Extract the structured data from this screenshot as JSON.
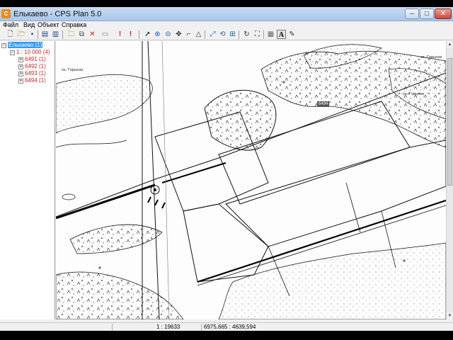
{
  "window": {
    "title": "Елькаево - CPS Plan 5.0",
    "app_icon": "cps-plan-icon",
    "controls": {
      "minimize": "–",
      "maximize": "□",
      "close": "✕"
    }
  },
  "menu": [
    {
      "label": "Файл"
    },
    {
      "label": "Вид"
    },
    {
      "label": "Объект"
    },
    {
      "label": "Справка"
    }
  ],
  "toolbar": [
    {
      "icon": "new-file-icon",
      "glyph": "🗋"
    },
    {
      "icon": "open-folder-icon",
      "glyph": "🗁"
    },
    {
      "icon": "save-icon",
      "glyph": "▪"
    },
    {
      "icon": "print-icon",
      "glyph": "▤"
    },
    {
      "icon": "print-preview-icon",
      "glyph": "▥"
    },
    {
      "icon": "open-layer-icon",
      "glyph": "🗀"
    },
    {
      "icon": "copy-icon",
      "glyph": "⧉"
    },
    {
      "icon": "delete-icon",
      "glyph": "✕"
    },
    {
      "icon": "properties-icon",
      "glyph": "▭"
    },
    {
      "icon": "alert-icon",
      "glyph": "!"
    },
    {
      "icon": "alert-warning-icon",
      "glyph": "!"
    },
    {
      "icon": "select-arrow-icon",
      "glyph": "➚"
    },
    {
      "icon": "zoom-in-icon",
      "glyph": "⊕"
    },
    {
      "icon": "zoom-out-icon",
      "glyph": "⊖"
    },
    {
      "icon": "pan-icon",
      "glyph": "✥"
    },
    {
      "icon": "angle-icon",
      "glyph": "⌐"
    },
    {
      "icon": "triangle-icon",
      "glyph": "△"
    },
    {
      "icon": "rotate-icon",
      "glyph": "⤢"
    },
    {
      "icon": "fit-rotate-icon",
      "glyph": "⟲"
    },
    {
      "icon": "zoom-page-icon",
      "glyph": "⊞"
    },
    {
      "icon": "refresh-icon",
      "glyph": "↻"
    },
    {
      "icon": "frame-icon",
      "glyph": "⛶"
    },
    {
      "icon": "grid-icon",
      "glyph": "▦"
    },
    {
      "icon": "text-icon",
      "glyph": "A"
    },
    {
      "icon": "edit-text-icon",
      "glyph": "✎"
    }
  ],
  "tree": {
    "root": "Елькаево (1)",
    "scale_node": "1 : 10 000 (4)",
    "sheets": [
      "6491 (1)",
      "6492 (1)",
      "6493 (1)",
      "6494 (1)"
    ]
  },
  "map": {
    "labels": [
      {
        "text": "оз. Горькое"
      },
      {
        "text": "оз. Горькое"
      },
      {
        "text": "оз. Горькое"
      }
    ],
    "tag": "6494"
  },
  "status": {
    "scale": "1 : 19633",
    "coordinates": "6975,665 : 4639,594"
  }
}
